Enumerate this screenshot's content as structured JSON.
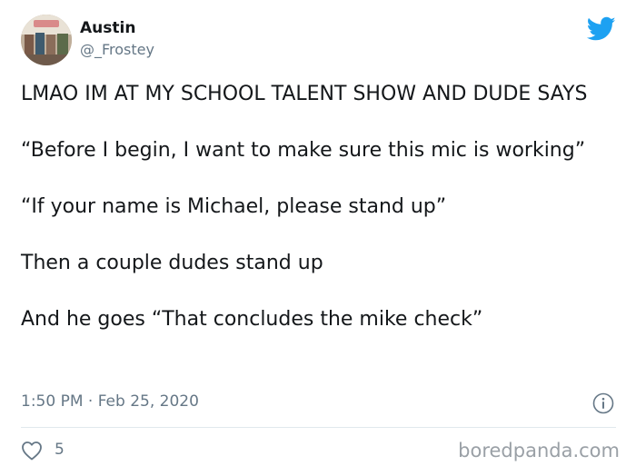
{
  "author": {
    "display_name": "Austin",
    "handle": "@_Frostey",
    "avatar_icon": "profile-photo"
  },
  "brand_icon": "twitter-bird-icon",
  "colors": {
    "brand": "#1da1f2",
    "text_primary": "#14171a",
    "text_secondary": "#657786",
    "divider": "#e1e8ed"
  },
  "tweet": {
    "paragraphs": [
      "LMAO IM AT MY SCHOOL TALENT SHOW AND DUDE SAYS",
      "“Before I begin, I want to make sure this mic is working”",
      "“If your name is Michael, please stand up”",
      "Then a couple dudes stand up",
      "And he goes “That concludes the mike check”"
    ],
    "timestamp": "1:50 PM · Feb 25, 2020"
  },
  "actions": {
    "like_icon": "heart-icon",
    "like_count": "5",
    "info_icon": "info-icon"
  },
  "watermark": "boredpanda.com"
}
